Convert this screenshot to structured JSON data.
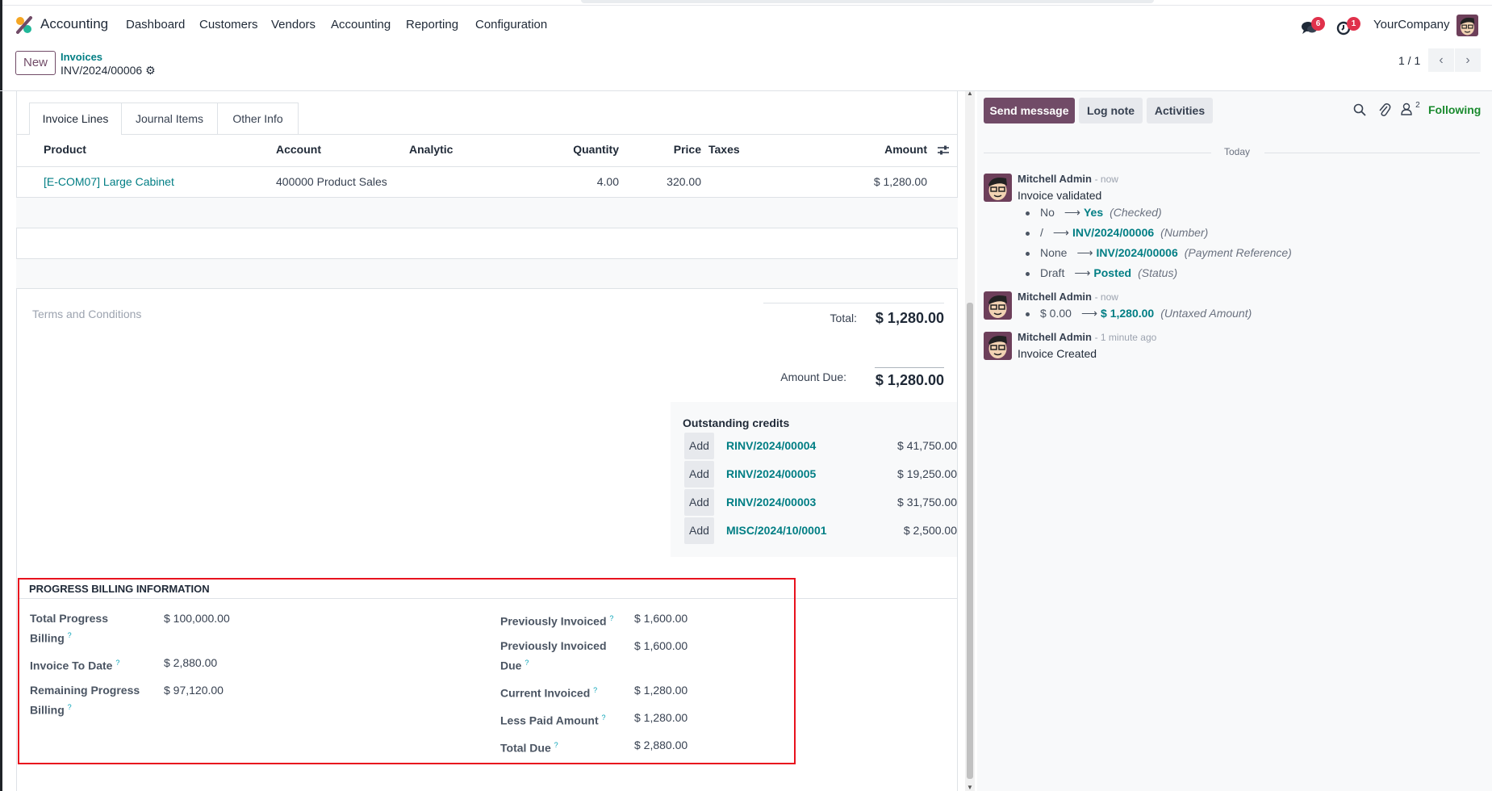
{
  "navbar": {
    "app_name": "Accounting",
    "menu": [
      "Dashboard",
      "Customers",
      "Vendors",
      "Accounting",
      "Reporting",
      "Configuration"
    ],
    "messages_badge": "6",
    "activities_badge": "1",
    "company": "YourCompany"
  },
  "control_panel": {
    "new_label": "New",
    "breadcrumb_parent": "Invoices",
    "breadcrumb_current": "INV/2024/00006",
    "pager": "1 / 1"
  },
  "tabs": [
    "Invoice Lines",
    "Journal Items",
    "Other Info"
  ],
  "lines_table": {
    "columns": [
      "Product",
      "Account",
      "Analytic",
      "Quantity",
      "Price",
      "Taxes",
      "Amount"
    ],
    "rows": [
      {
        "product": "[E-COM07] Large Cabinet",
        "account": "400000 Product Sales",
        "analytic": "",
        "quantity": "4.00",
        "price": "320.00",
        "taxes": "",
        "amount": "$ 1,280.00"
      }
    ]
  },
  "terms_placeholder": "Terms and Conditions",
  "totals": {
    "total_label": "Total:",
    "total_value": "$ 1,280.00",
    "amount_due_label": "Amount Due:",
    "amount_due_value": "$ 1,280.00"
  },
  "outstanding_credits": {
    "title": "Outstanding credits",
    "add_label": "Add",
    "items": [
      {
        "ref": "RINV/2024/00004",
        "amount": "$ 41,750.00"
      },
      {
        "ref": "RINV/2024/00005",
        "amount": "$ 19,250.00"
      },
      {
        "ref": "RINV/2024/00003",
        "amount": "$ 31,750.00"
      },
      {
        "ref": "MISC/2024/10/0001",
        "amount": "$ 2,500.00"
      }
    ]
  },
  "progress_billing": {
    "title": "PROGRESS BILLING INFORMATION",
    "left": [
      {
        "label": "Total Progress Billing",
        "value": "$ 100,000.00"
      },
      {
        "label": "Invoice To Date",
        "value": "$ 2,880.00"
      },
      {
        "label": "Remaining Progress Billing",
        "value": "$ 97,120.00"
      }
    ],
    "right": [
      {
        "label": "Previously Invoiced",
        "value": "$ 1,600.00"
      },
      {
        "label": "Previously Invoiced Due",
        "value": "$ 1,600.00"
      },
      {
        "label": "Current Invoiced",
        "value": "$ 1,280.00"
      },
      {
        "label": "Less Paid Amount",
        "value": "$ 1,280.00"
      },
      {
        "label": "Total Due",
        "value": "$ 2,880.00"
      }
    ],
    "help_mark": "?"
  },
  "chatter": {
    "send_message": "Send message",
    "log_note": "Log note",
    "activities": "Activities",
    "followers_count": "2",
    "following": "Following",
    "date_separator": "Today",
    "messages": [
      {
        "author": "Mitchell Admin",
        "time": "- now",
        "body": "Invoice validated",
        "changes": [
          {
            "old": "No",
            "new": "Yes",
            "field": "(Checked)"
          },
          {
            "old": "/",
            "new": "INV/2024/00006",
            "field": "(Number)"
          },
          {
            "old": "None",
            "new": "INV/2024/00006",
            "field": "(Payment Reference)"
          },
          {
            "old": "Draft",
            "new": "Posted",
            "field": "(Status)"
          }
        ]
      },
      {
        "author": "Mitchell Admin",
        "time": "- now",
        "body": "",
        "changes": [
          {
            "old": "$ 0.00",
            "new": "$ 1,280.00",
            "field": "(Untaxed Amount)"
          }
        ]
      },
      {
        "author": "Mitchell Admin",
        "time": "- 1 minute ago",
        "body": "Invoice Created",
        "changes": []
      }
    ]
  },
  "colors": {
    "brand": "#714b67",
    "link": "#017e84",
    "following": "#1a8a2e",
    "highlight_box": "#e8121e",
    "badge": "#e0314b"
  }
}
